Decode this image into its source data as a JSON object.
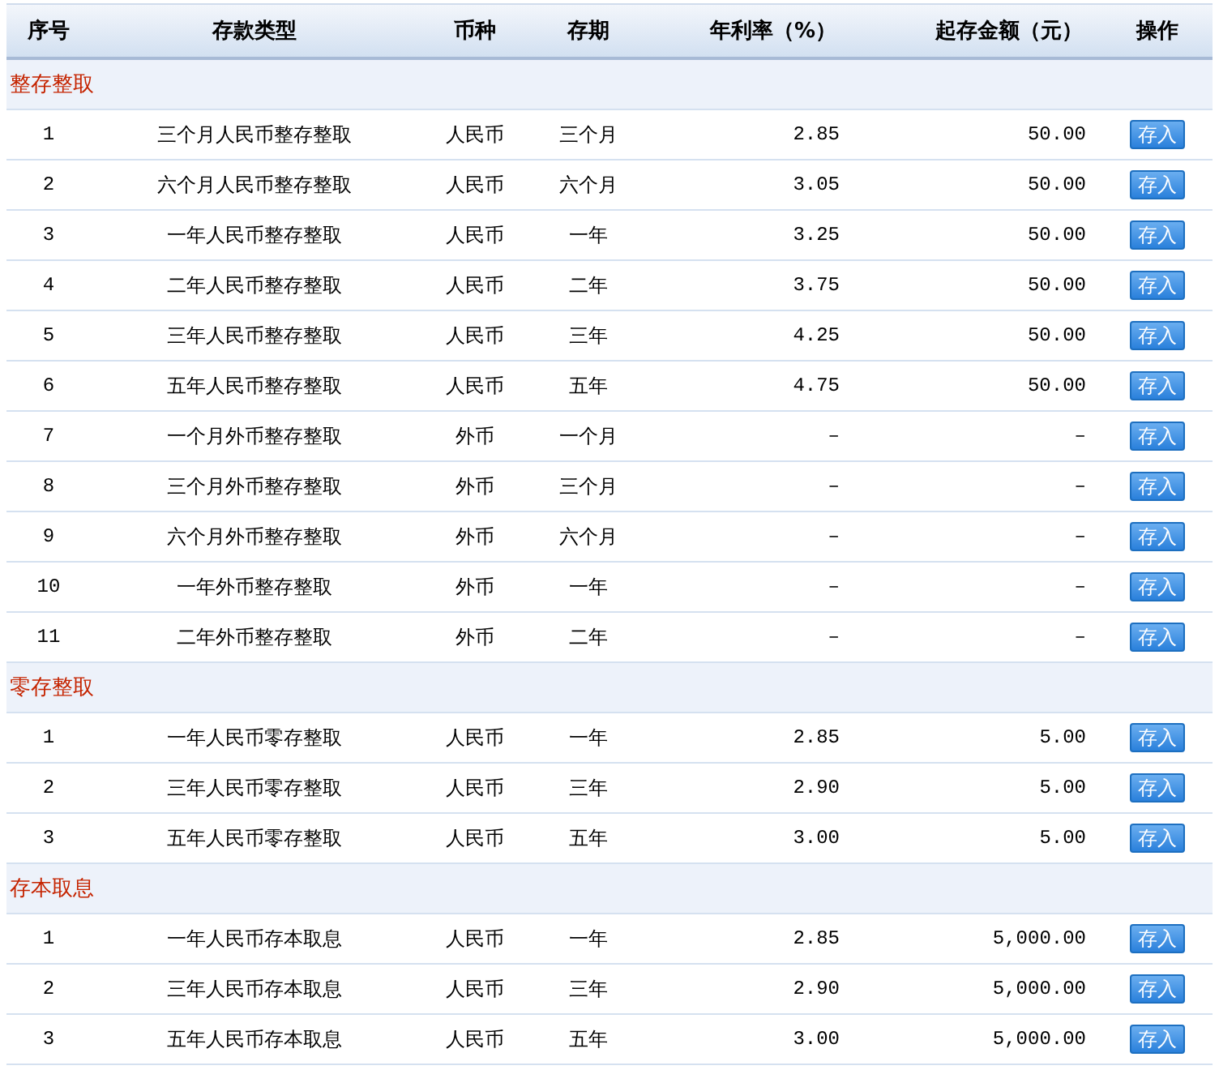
{
  "columns": [
    "序号",
    "存款类型",
    "币种",
    "存期",
    "年利率（%）",
    "起存金额（元）",
    "操作"
  ],
  "groups": [
    {
      "title": "整存整取",
      "rows": [
        {
          "no": "1",
          "type": "三个月人民币整存整取",
          "currency": "人民币",
          "term": "三个月",
          "rate": "2.85",
          "min_amount": "50.00",
          "action": "存入"
        },
        {
          "no": "2",
          "type": "六个月人民币整存整取",
          "currency": "人民币",
          "term": "六个月",
          "rate": "3.05",
          "min_amount": "50.00",
          "action": "存入"
        },
        {
          "no": "3",
          "type": "一年人民币整存整取",
          "currency": "人民币",
          "term": "一年",
          "rate": "3.25",
          "min_amount": "50.00",
          "action": "存入"
        },
        {
          "no": "4",
          "type": "二年人民币整存整取",
          "currency": "人民币",
          "term": "二年",
          "rate": "3.75",
          "min_amount": "50.00",
          "action": "存入"
        },
        {
          "no": "5",
          "type": "三年人民币整存整取",
          "currency": "人民币",
          "term": "三年",
          "rate": "4.25",
          "min_amount": "50.00",
          "action": "存入"
        },
        {
          "no": "6",
          "type": "五年人民币整存整取",
          "currency": "人民币",
          "term": "五年",
          "rate": "4.75",
          "min_amount": "50.00",
          "action": "存入"
        },
        {
          "no": "7",
          "type": "一个月外币整存整取",
          "currency": "外币",
          "term": "一个月",
          "rate": "–",
          "min_amount": "–",
          "action": "存入"
        },
        {
          "no": "8",
          "type": "三个月外币整存整取",
          "currency": "外币",
          "term": "三个月",
          "rate": "–",
          "min_amount": "–",
          "action": "存入"
        },
        {
          "no": "9",
          "type": "六个月外币整存整取",
          "currency": "外币",
          "term": "六个月",
          "rate": "–",
          "min_amount": "–",
          "action": "存入"
        },
        {
          "no": "10",
          "type": "一年外币整存整取",
          "currency": "外币",
          "term": "一年",
          "rate": "–",
          "min_amount": "–",
          "action": "存入"
        },
        {
          "no": "11",
          "type": "二年外币整存整取",
          "currency": "外币",
          "term": "二年",
          "rate": "–",
          "min_amount": "–",
          "action": "存入"
        }
      ]
    },
    {
      "title": "零存整取",
      "rows": [
        {
          "no": "1",
          "type": "一年人民币零存整取",
          "currency": "人民币",
          "term": "一年",
          "rate": "2.85",
          "min_amount": "5.00",
          "action": "存入"
        },
        {
          "no": "2",
          "type": "三年人民币零存整取",
          "currency": "人民币",
          "term": "三年",
          "rate": "2.90",
          "min_amount": "5.00",
          "action": "存入"
        },
        {
          "no": "3",
          "type": "五年人民币零存整取",
          "currency": "人民币",
          "term": "五年",
          "rate": "3.00",
          "min_amount": "5.00",
          "action": "存入"
        }
      ]
    },
    {
      "title": "存本取息",
      "rows": [
        {
          "no": "1",
          "type": "一年人民币存本取息",
          "currency": "人民币",
          "term": "一年",
          "rate": "2.85",
          "min_amount": "5,000.00",
          "action": "存入"
        },
        {
          "no": "2",
          "type": "三年人民币存本取息",
          "currency": "人民币",
          "term": "三年",
          "rate": "2.90",
          "min_amount": "5,000.00",
          "action": "存入"
        },
        {
          "no": "3",
          "type": "五年人民币存本取息",
          "currency": "人民币",
          "term": "五年",
          "rate": "3.00",
          "min_amount": "5,000.00",
          "action": "存入"
        }
      ]
    }
  ]
}
